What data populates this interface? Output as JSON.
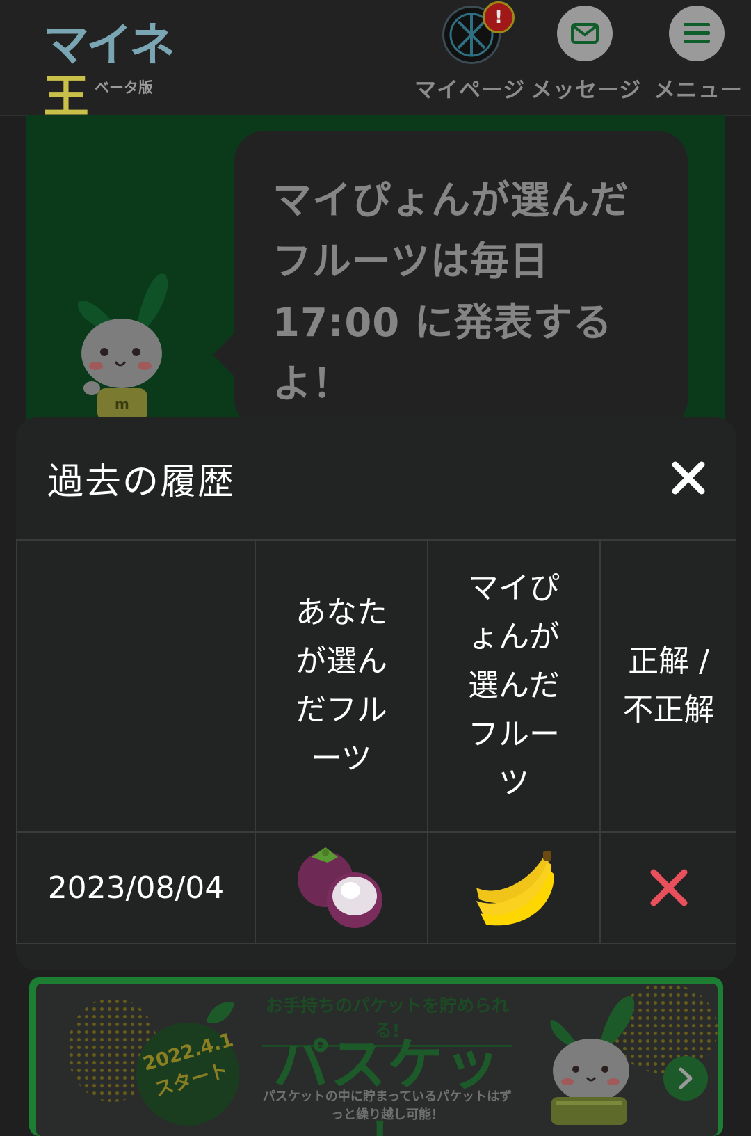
{
  "header": {
    "logo_text": "マイネ王",
    "beta_label": "ベータ版",
    "nav": {
      "mypage_label": "マイページ",
      "message_label": "メッセージ",
      "menu_label": "メニュー",
      "alert_badge": "!"
    }
  },
  "announcement": {
    "text": "マイぴょんが選んだフルーツは毎日 17:00 に発表するよ！"
  },
  "history_modal": {
    "title": "過去の履歴",
    "columns": {
      "date": "",
      "your_fruit": "あなたが選んだフルーツ",
      "mypyon_fruit": "マイぴょんが選んだフルーツ",
      "result": "正解 / 不正解"
    },
    "rows": [
      {
        "date": "2023/08/04",
        "your_fruit": "mangosteen-icon",
        "mypyon_fruit": "banana-icon",
        "result": "incorrect-x-icon"
      }
    ]
  },
  "ad": {
    "start_date": "2022.4.1 スタート",
    "catch_copy": "お手持ちのパケットを貯められる!",
    "title": "パスケット",
    "subtitle": "パスケットの中に貯まっているパケットはずっと繰り越し可能！"
  },
  "colors": {
    "brand_green": "#1c7d33",
    "incorrect_red": "#e8505b",
    "banner_green": "#0b3a1b"
  }
}
